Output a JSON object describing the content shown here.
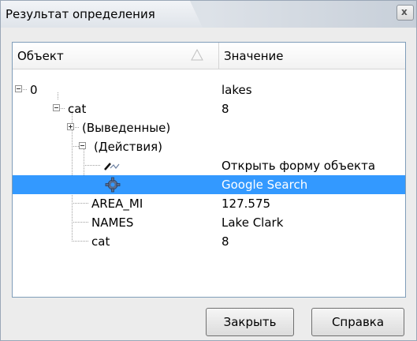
{
  "window": {
    "title": "Результат определения",
    "close_label": "x"
  },
  "tree": {
    "columns": {
      "object": "Объект",
      "value": "Значение"
    },
    "rows": [
      {
        "label": "0",
        "value": "lakes"
      },
      {
        "label": "cat",
        "value": "8"
      },
      {
        "label": "(Выведенные)",
        "value": ""
      },
      {
        "label": "(Действия)",
        "value": ""
      },
      {
        "label": "",
        "value": "Открыть форму объекта",
        "icon": "pen-draw-icon"
      },
      {
        "label": "",
        "value": "Google Search",
        "icon": "gear-icon"
      },
      {
        "label": "AREA_MI",
        "value": "127.575"
      },
      {
        "label": "NAMES",
        "value": "Lake Clark"
      },
      {
        "label": "cat",
        "value": "8"
      }
    ]
  },
  "buttons": {
    "close": "Закрыть",
    "help": "Справка"
  },
  "colors": {
    "selection": "#3399ff",
    "border": "#7f9db9"
  }
}
